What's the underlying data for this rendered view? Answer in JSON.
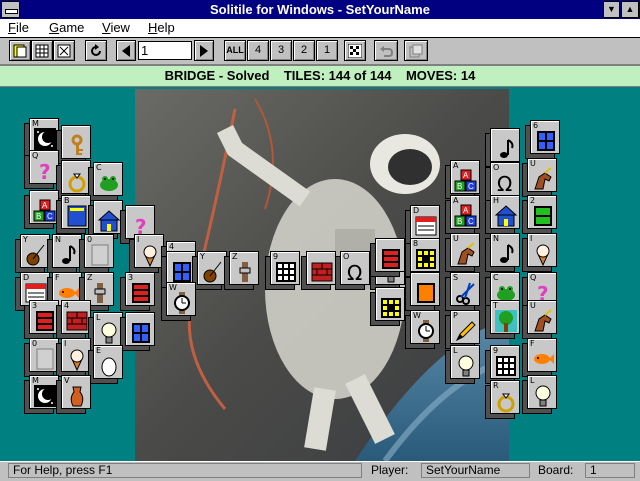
{
  "window": {
    "title": "Solitile for Windows - SetYourName"
  },
  "menu": {
    "items": [
      {
        "label": "File",
        "hotkey": "F"
      },
      {
        "label": "Game",
        "hotkey": "G"
      },
      {
        "label": "View",
        "hotkey": "V"
      },
      {
        "label": "Help",
        "hotkey": "H"
      }
    ]
  },
  "toolbar": {
    "level_value": "1",
    "all_label": "ALL",
    "layer_4": "4",
    "layer_3": "3",
    "layer_2": "2",
    "layer_1": "1"
  },
  "status_line": {
    "text": "BRIDGE - Solved    TILES: 144 of 144    MOVES: 14"
  },
  "statusbar": {
    "help_text": "For Help, press F1",
    "player_label": "Player:",
    "player_value": "SetYourName",
    "board_label": "Board:",
    "board_value": "1"
  },
  "tiles": [
    {
      "letter": "M",
      "icon": "moon"
    },
    {
      "letter": "",
      "icon": "key"
    },
    {
      "letter": "Q",
      "icon": "question"
    },
    {
      "letter": "",
      "icon": "ring"
    },
    {
      "letter": "C",
      "icon": "frog"
    },
    {
      "letter": "",
      "icon": "blocks"
    },
    {
      "letter": "B",
      "icon": "book"
    },
    {
      "letter": "",
      "icon": "house"
    },
    {
      "letter": "",
      "icon": "question"
    },
    {
      "letter": "Y",
      "icon": "yoyo"
    },
    {
      "letter": "N",
      "icon": "note"
    },
    {
      "letter": "0",
      "icon": "blank"
    },
    {
      "letter": "I",
      "icon": "icecream"
    },
    {
      "letter": "4",
      "icon": "brick"
    },
    {
      "letter": "",
      "icon": "window"
    },
    {
      "letter": "Y",
      "icon": "yoyo"
    },
    {
      "letter": "Z",
      "icon": "zipper"
    },
    {
      "letter": "9",
      "icon": "grid9"
    },
    {
      "letter": "",
      "icon": "brick"
    },
    {
      "letter": "O",
      "icon": "omega"
    },
    {
      "letter": "L",
      "icon": "bulb"
    },
    {
      "letter": "D",
      "icon": "calendar"
    },
    {
      "letter": "F",
      "icon": "fish"
    },
    {
      "letter": "Z",
      "icon": "zipper"
    },
    {
      "letter": "3",
      "icon": "bars3"
    },
    {
      "letter": "W",
      "icon": "watch"
    },
    {
      "letter": "3",
      "icon": "bars3"
    },
    {
      "letter": "4",
      "icon": "brick"
    },
    {
      "letter": "L",
      "icon": "bulb"
    },
    {
      "letter": "",
      "icon": "window"
    },
    {
      "letter": "0",
      "icon": "blank"
    },
    {
      "letter": "I",
      "icon": "icecream"
    },
    {
      "letter": "E",
      "icon": "egg"
    },
    {
      "letter": "M",
      "icon": "moon"
    },
    {
      "letter": "V",
      "icon": "vase"
    },
    {
      "letter": "",
      "icon": "note"
    },
    {
      "letter": "6",
      "icon": "window"
    },
    {
      "letter": "A",
      "icon": "blocks"
    },
    {
      "letter": "O",
      "icon": "omega"
    },
    {
      "letter": "U",
      "icon": "unicorn"
    },
    {
      "letter": "D",
      "icon": "calendar"
    },
    {
      "letter": "A",
      "icon": "blocks"
    },
    {
      "letter": "H",
      "icon": "house"
    },
    {
      "letter": "2",
      "icon": "bars2"
    },
    {
      "letter": "",
      "icon": "bars3"
    },
    {
      "letter": "8",
      "icon": "grid8"
    },
    {
      "letter": "U",
      "icon": "unicorn"
    },
    {
      "letter": "N",
      "icon": "note"
    },
    {
      "letter": "I",
      "icon": "icecream"
    },
    {
      "letter": "",
      "icon": "grid8"
    },
    {
      "letter": "",
      "icon": "rect"
    },
    {
      "letter": "S",
      "icon": "scissors"
    },
    {
      "letter": "C",
      "icon": "frog"
    },
    {
      "letter": "Q",
      "icon": "question"
    },
    {
      "letter": "W",
      "icon": "watch"
    },
    {
      "letter": "P",
      "icon": "pencil"
    },
    {
      "letter": "T",
      "icon": "tree"
    },
    {
      "letter": "U",
      "icon": "unicorn"
    },
    {
      "letter": "L",
      "icon": "bulb"
    },
    {
      "letter": "9",
      "icon": "grid9"
    },
    {
      "letter": "F",
      "icon": "fish"
    },
    {
      "letter": "R",
      "icon": "ring"
    },
    {
      "letter": "L",
      "icon": "bulb"
    }
  ]
}
